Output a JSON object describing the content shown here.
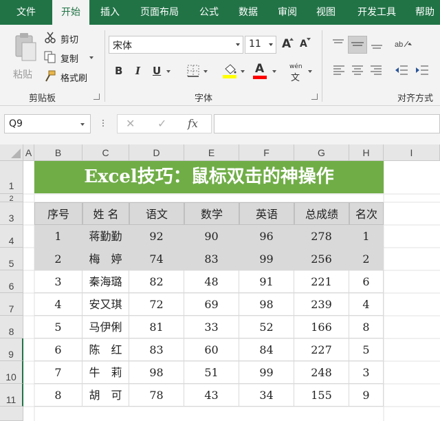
{
  "ribbon_tabs": [
    "文件",
    "开始",
    "插入",
    "页面布局",
    "公式",
    "数据",
    "审阅",
    "视图",
    "开发工具",
    "帮助"
  ],
  "active_tab": "开始",
  "clipboard": {
    "paste_label": "粘贴",
    "cut_label": "剪切",
    "copy_label": "复制",
    "format_painter_label": "格式刷",
    "group_label": "剪贴板"
  },
  "font": {
    "name": "宋体",
    "size": "11",
    "bold_label": "B",
    "italic_label": "I",
    "underline_label": "U",
    "grow_label": "A",
    "shrink_label": "A",
    "font_color_label": "A",
    "phonetic_top": "wén",
    "phonetic_bottom": "文",
    "group_label": "字体",
    "highlight_color": "#ffff00",
    "font_color": "#ff0000"
  },
  "alignment": {
    "group_label": "对齐方式"
  },
  "formula_bar": {
    "name_box": "Q9",
    "cancel_symbol": "✕",
    "enter_symbol": "✓",
    "function_symbol": "fx",
    "formula": ""
  },
  "columns": [
    "A",
    "B",
    "C",
    "D",
    "E",
    "F",
    "G",
    "H",
    "I"
  ],
  "rows": [
    "1",
    "2",
    "3",
    "4",
    "5",
    "6",
    "7",
    "8",
    "9",
    "10",
    "11"
  ],
  "sheet": {
    "title": "Excel技巧：鼠标双击的神操作",
    "title_color": "#70ad47",
    "headers": [
      "序号",
      "姓 名",
      "语文",
      "数学",
      "英语",
      "总成绩",
      "名次"
    ],
    "data_rows": [
      [
        "1",
        "蒋勤勤",
        "92",
        "90",
        "96",
        "278",
        "1"
      ],
      [
        "2",
        "梅　婷",
        "74",
        "83",
        "99",
        "256",
        "2"
      ],
      [
        "3",
        "秦海璐",
        "82",
        "48",
        "91",
        "221",
        "6"
      ],
      [
        "4",
        "安又琪",
        "72",
        "69",
        "98",
        "239",
        "4"
      ],
      [
        "5",
        "马伊俐",
        "81",
        "33",
        "52",
        "166",
        "8"
      ],
      [
        "6",
        "陈　红",
        "83",
        "60",
        "84",
        "227",
        "5"
      ],
      [
        "7",
        "牛　莉",
        "98",
        "51",
        "99",
        "248",
        "3"
      ],
      [
        "8",
        "胡　可",
        "78",
        "43",
        "34",
        "155",
        "9"
      ]
    ]
  }
}
